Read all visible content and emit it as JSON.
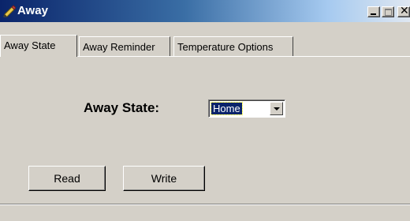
{
  "window": {
    "title": "Away",
    "icon": "pencil-icon"
  },
  "titlebar_buttons": {
    "minimize_icon": "minimize-icon",
    "maximize_icon": "maximize-icon",
    "close_label": "✕"
  },
  "tabs": [
    {
      "label": "Away State",
      "active": true
    },
    {
      "label": "Away Reminder",
      "active": false
    },
    {
      "label": "Temperature Options",
      "active": false
    }
  ],
  "away_state": {
    "label": "Away State:",
    "selected": "Home"
  },
  "buttons": {
    "read_label": "Read",
    "write_label": "Write"
  },
  "colors": {
    "title_gradient_start": "#0a246a",
    "face": "#d4d0c8",
    "selection": "#0a246a"
  }
}
